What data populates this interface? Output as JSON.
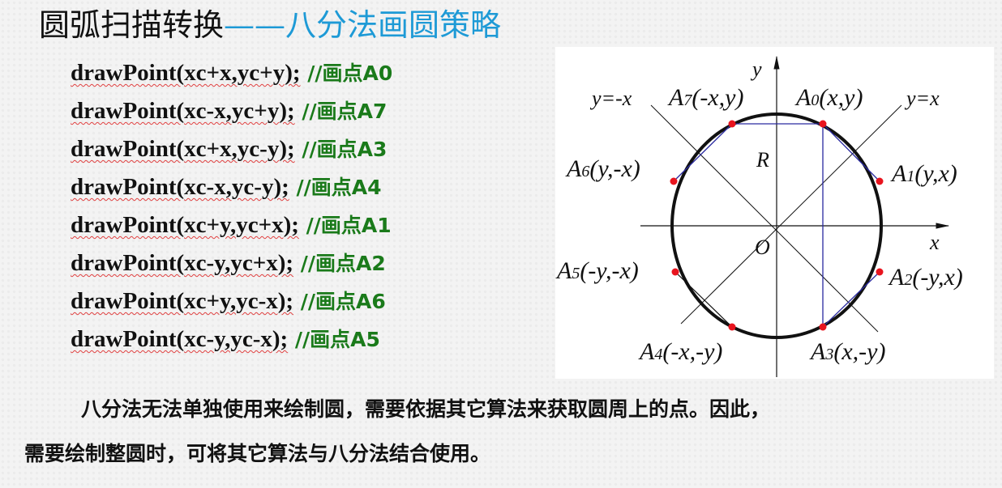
{
  "title": {
    "main": "圆弧扫描转换",
    "accent": "——八分法画圆策略"
  },
  "code_lines": [
    {
      "call": "drawPoint(xc+x,yc+y);",
      "comment": " //画点A0"
    },
    {
      "call": "drawPoint(xc-x,yc+y);",
      "comment": " //画点A7"
    },
    {
      "call": "drawPoint(xc+x,yc-y);",
      "comment": " //画点A3"
    },
    {
      "call": "drawPoint(xc-x,yc-y);",
      "comment": " //画点A4"
    },
    {
      "call": "drawPoint(xc+y,yc+x);",
      "comment": " //画点A1"
    },
    {
      "call": "drawPoint(xc-y,yc+x);",
      "comment": " //画点A2"
    },
    {
      "call": "drawPoint(xc+y,yc-x);",
      "comment": " //画点A6"
    },
    {
      "call": "drawPoint(xc-y,yc-x);",
      "comment": " //画点A5"
    }
  ],
  "diagram": {
    "axis_x": "x",
    "axis_y": "y",
    "origin": "O",
    "radius": "R",
    "line_pos": "y=x",
    "line_neg": "y=-x",
    "points": [
      {
        "name": "A",
        "sub": "0",
        "coords": "(x,y)"
      },
      {
        "name": "A",
        "sub": "1",
        "coords": "(y,x)"
      },
      {
        "name": "A",
        "sub": "2",
        "coords": "(-y,x)"
      },
      {
        "name": "A",
        "sub": "3",
        "coords": "(x,-y)"
      },
      {
        "name": "A",
        "sub": "4",
        "coords": "(-x,-y)"
      },
      {
        "name": "A",
        "sub": "5",
        "coords": "(-y,-x)"
      },
      {
        "name": "A",
        "sub": "6",
        "coords": "(y,-x)"
      },
      {
        "name": "A",
        "sub": "7",
        "coords": "(-x,y)"
      }
    ],
    "point_color": "#e8141e",
    "chord_color": "#2a2aa0"
  },
  "paragraph": {
    "line1": "八分法无法单独使用来绘制圆，需要依据其它算法来获取圆周上的点。因此，",
    "line2": "需要绘制整圆时，可将其它算法与八分法结合使用。"
  }
}
